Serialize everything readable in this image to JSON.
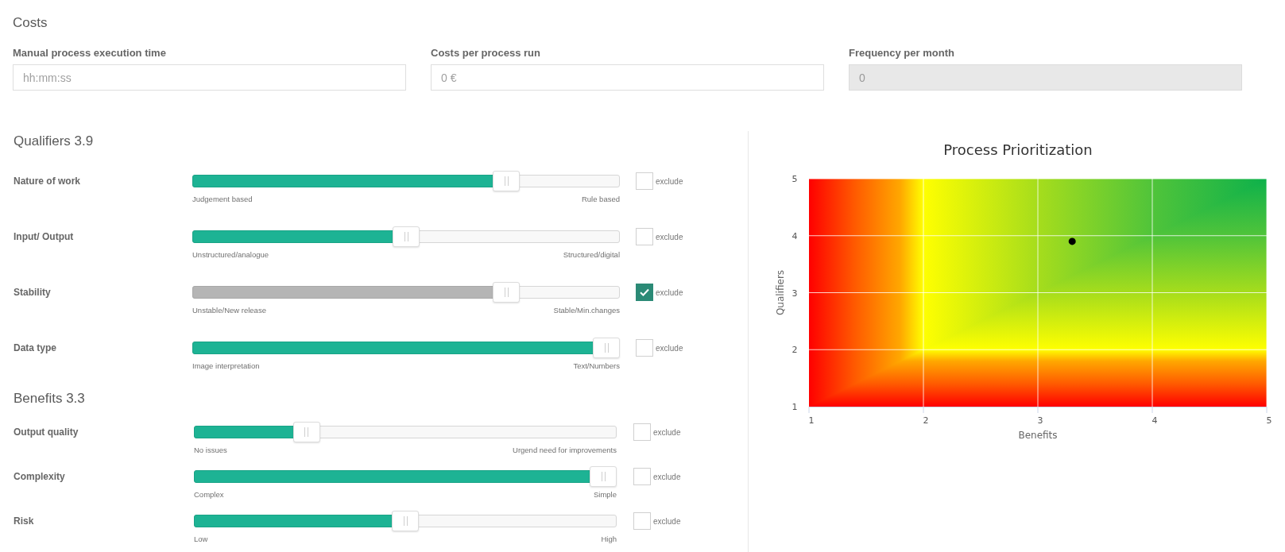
{
  "costs": {
    "title": "Costs",
    "fields": [
      {
        "label": "Manual process execution time",
        "placeholder": "hh:mm:ss",
        "disabled": false
      },
      {
        "label": "Costs per process run",
        "placeholder": "0 €",
        "disabled": false
      },
      {
        "label": "Frequency per month",
        "placeholder": "0",
        "disabled": true
      }
    ]
  },
  "criteria": [
    {
      "title": "Qualifiers 3.9",
      "rows": [
        {
          "label": "Nature of work",
          "level": 0.75,
          "min_label": "Judgement based",
          "max_label": "Rule based",
          "checked": false,
          "checkbox_label": "exclude"
        },
        {
          "label": "Input/ Output",
          "level": 0.5,
          "min_label": "Unstructured/analogue",
          "max_label": "Structured/digital",
          "checked": false,
          "checkbox_label": "exclude"
        },
        {
          "label": "Stability",
          "level": 0.75,
          "min_label": "Unstable/New release",
          "max_label": "Stable/Min.changes",
          "checked": true,
          "checkbox_label": "exclude"
        },
        {
          "label": "Data type",
          "level": 1.0,
          "min_label": "Image interpretation",
          "max_label": "Text/Numbers",
          "checked": false,
          "checkbox_label": "exclude"
        }
      ]
    },
    {
      "title": "Benefits 3.3",
      "rows": [
        {
          "label": "Output quality",
          "level": 0.25,
          "min_label": "No issues",
          "max_label": "Urgend need for improvements",
          "checked": false,
          "checkbox_label": "exclude"
        },
        {
          "label": "Complexity",
          "level": 1.0,
          "min_label": "Complex",
          "max_label": "Simple",
          "checked": false,
          "checkbox_label": "exclude"
        },
        {
          "label": "Risk",
          "level": 0.5,
          "min_label": "Low",
          "max_label": "High",
          "checked": false,
          "checkbox_label": "exclude"
        }
      ]
    }
  ],
  "chart": {
    "chart_data": {
      "type": "scatter",
      "title": "Process Prioritization",
      "xlabel": "Benefits",
      "ylabel": "Qualifiers",
      "xlim": [
        1,
        5
      ],
      "ylim": [
        1,
        5
      ],
      "xticks": [
        1,
        2,
        3,
        4,
        5
      ],
      "yticks": [
        1,
        2,
        3,
        4,
        5
      ],
      "grid": true,
      "x": [
        3.3
      ],
      "values": [
        3.9
      ]
    }
  }
}
